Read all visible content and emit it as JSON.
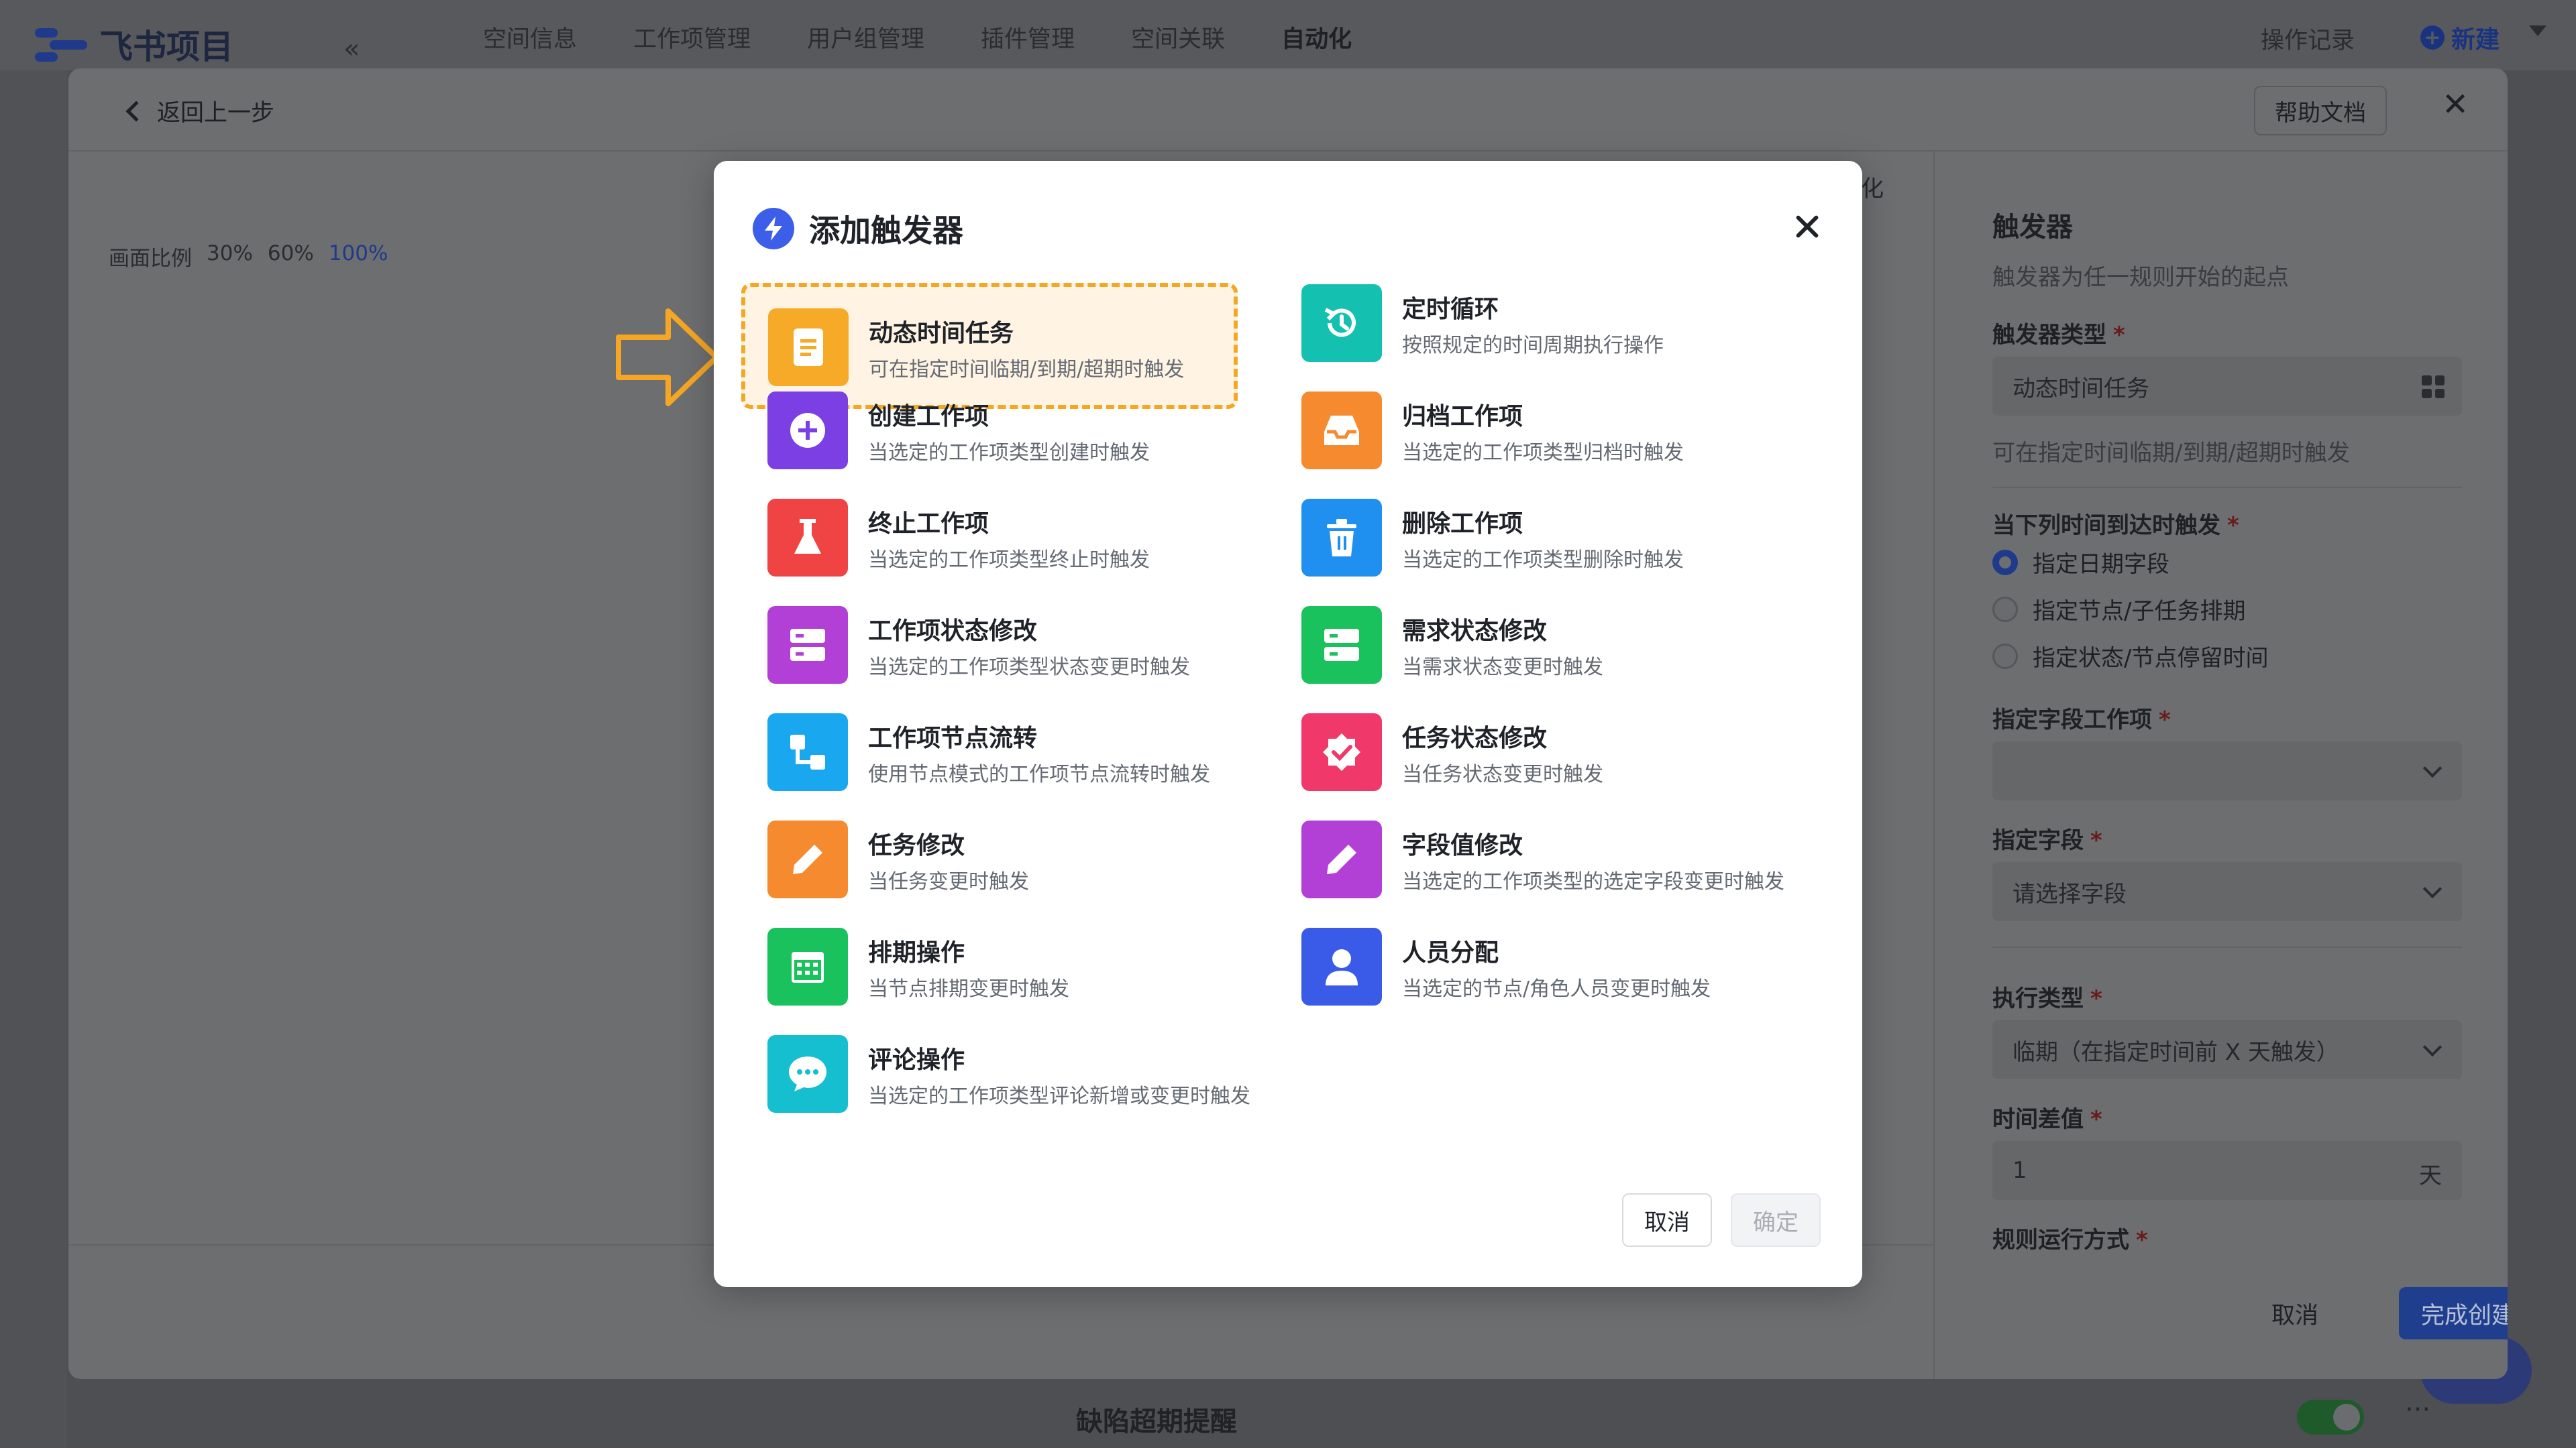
{
  "app": {
    "logo_text": "飞书项目",
    "nav_tabs": [
      "空间信息",
      "工作项管理",
      "用户组管理",
      "插件管理",
      "空间关联",
      "自动化"
    ],
    "active_tab": "自动化",
    "op_record": "操作记录",
    "new_label": "新建"
  },
  "panel": {
    "back_label": "返回上一步",
    "help_label": "帮助文档",
    "zoom_label": "画面比例",
    "zoom_options": [
      "30%",
      "60%",
      "100%"
    ],
    "zoom_active": "100%",
    "canvas_label": "化"
  },
  "right_panel": {
    "title": "触发器",
    "subtitle": "触发器为任一规则开始的起点",
    "trigger_type_label": "触发器类型",
    "trigger_type_value": "动态时间任务",
    "trigger_type_desc": "可在指定时间临期/到期/超期时触发",
    "when_label": "当下列时间到达时触发",
    "radios": [
      {
        "label": "指定日期字段",
        "checked": true
      },
      {
        "label": "指定节点/子任务排期",
        "checked": false
      },
      {
        "label": "指定状态/节点停留时间",
        "checked": false
      }
    ],
    "field_item_label": "指定字段工作项",
    "field_item_value": "",
    "field_label": "指定字段",
    "field_placeholder": "请选择字段",
    "exec_type_label": "执行类型",
    "exec_type_value": "临期（在指定时间前 X 天触发）",
    "time_diff_label": "时间差值",
    "time_diff_value": "1",
    "time_diff_unit": "天",
    "run_mode_label": "规则运行方式",
    "required_mark": "*",
    "cancel_label": "取消",
    "finish_label": "完成创建"
  },
  "bottom": {
    "rule_title": "缺陷超期提醒",
    "more": "···"
  },
  "modal": {
    "title": "添加触发器",
    "cancel_label": "取消",
    "ok_label": "确定",
    "triggers": [
      {
        "name": "动态时间任务",
        "desc": "可在指定时间临期/到期/超期时触发",
        "icon": "document-icon",
        "color": "#f7a928",
        "selected": true
      },
      {
        "name": "定时循环",
        "desc": "按照规定的时间周期执行操作",
        "icon": "history-icon",
        "color": "#14c0b0",
        "selected": false
      },
      {
        "name": "创建工作项",
        "desc": "当选定的工作项类型创建时触发",
        "icon": "plus-circle-icon",
        "color": "#7b3fe4",
        "selected": false
      },
      {
        "name": "归档工作项",
        "desc": "当选定的工作项类型归档时触发",
        "icon": "inbox-icon",
        "color": "#f58b2e",
        "selected": false
      },
      {
        "name": "终止工作项",
        "desc": "当选定的工作项类型终止时触发",
        "icon": "flask-icon",
        "color": "#f04444",
        "selected": false
      },
      {
        "name": "删除工作项",
        "desc": "当选定的工作项类型删除时触发",
        "icon": "trash-icon",
        "color": "#1f8ff0",
        "selected": false
      },
      {
        "name": "工作项状态修改",
        "desc": "当选定的工作项类型状态变更时触发",
        "icon": "server-icon",
        "color": "#b23fd6",
        "selected": false
      },
      {
        "name": "需求状态修改",
        "desc": "当需求状态变更时触发",
        "icon": "server-icon",
        "color": "#19c25c",
        "selected": false
      },
      {
        "name": "工作项节点流转",
        "desc": "使用节点模式的工作项节点流转时触发",
        "icon": "flow-icon",
        "color": "#19a7f0",
        "selected": false
      },
      {
        "name": "任务状态修改",
        "desc": "当任务状态变更时触发",
        "icon": "badge-check-icon",
        "color": "#f0386b",
        "selected": false
      },
      {
        "name": "任务修改",
        "desc": "当任务变更时触发",
        "icon": "pencil-icon",
        "color": "#f58b2e",
        "selected": false
      },
      {
        "name": "字段值修改",
        "desc": "当选定的工作项类型的选定字段变更时触发",
        "icon": "pencil-icon",
        "color": "#b23fd6",
        "selected": false
      },
      {
        "name": "排期操作",
        "desc": "当节点排期变更时触发",
        "icon": "calendar-icon",
        "color": "#19c25c",
        "selected": false
      },
      {
        "name": "人员分配",
        "desc": "当选定的节点/角色人员变更时触发",
        "icon": "user-icon",
        "color": "#3a5be8",
        "selected": false
      },
      {
        "name": "评论操作",
        "desc": "当选定的工作项类型评论新增或变更时触发",
        "icon": "chat-icon",
        "color": "#16bfd0",
        "selected": false
      }
    ]
  },
  "colors": {
    "highlight_border": "#f5a623",
    "highlight_bg": "#fff4e3",
    "arrow": "#f5a623",
    "accent": "#3d5ee8"
  }
}
